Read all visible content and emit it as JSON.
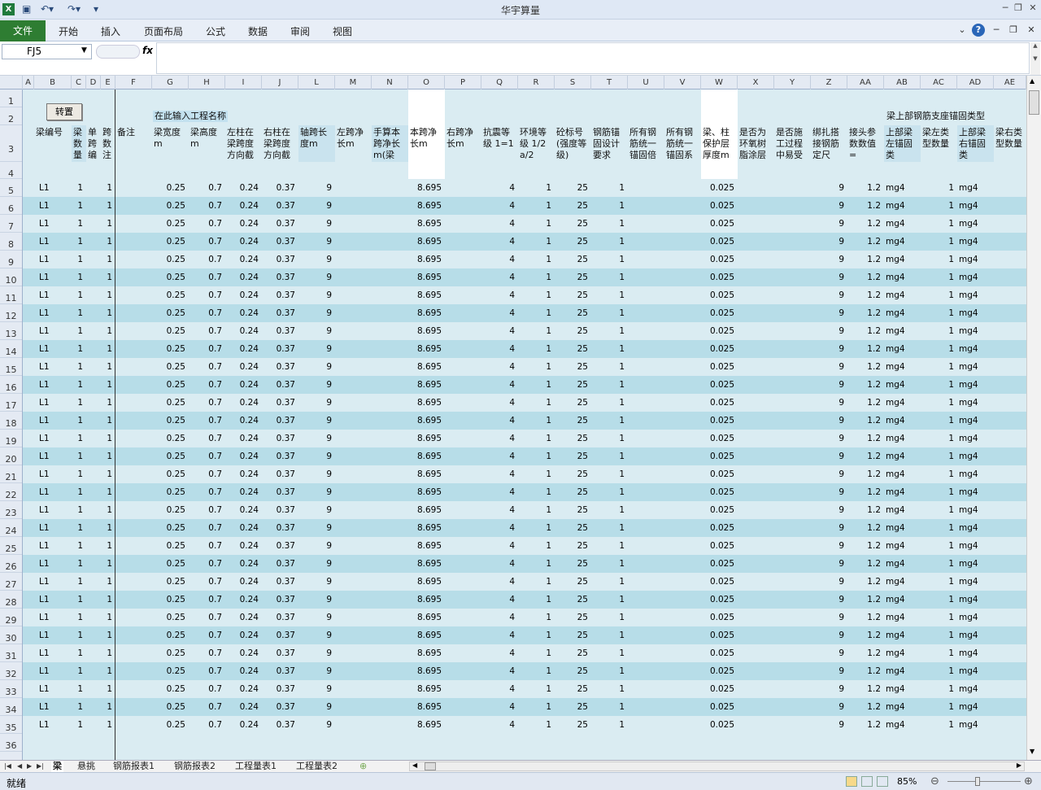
{
  "app": {
    "title": "华宇算量",
    "icon": "excel-icon"
  },
  "ribbon": {
    "file": "文件",
    "tabs": [
      "开始",
      "插入",
      "页面布局",
      "公式",
      "数据",
      "审阅",
      "视图"
    ]
  },
  "formula": {
    "namebox": "FJ5",
    "fx": "fx",
    "value": ""
  },
  "columns": [
    "A",
    "B",
    "C",
    "D",
    "E",
    "F",
    "G",
    "H",
    "I",
    "J",
    "L",
    "M",
    "N",
    "O",
    "P",
    "Q",
    "R",
    "S",
    "T",
    "U",
    "V",
    "W",
    "X",
    "Y",
    "Z",
    "AA",
    "AB",
    "AC",
    "AD",
    "AE"
  ],
  "rows": [
    "1",
    "2",
    "3",
    "4",
    "5",
    "6",
    "7",
    "8",
    "9",
    "10",
    "11",
    "12",
    "13",
    "14",
    "15",
    "16",
    "17",
    "18",
    "19",
    "20",
    "21",
    "22",
    "23",
    "24",
    "25",
    "26",
    "27",
    "28",
    "29",
    "30",
    "31",
    "32",
    "33",
    "34",
    "35",
    "36"
  ],
  "button": "转置",
  "project_label": "在此输入工程名称",
  "group_header": "梁上部钢筋支座锚固类型",
  "headers": {
    "B": "梁编号",
    "C": "梁数量",
    "D": "单跨编",
    "E": "跨数注",
    "F": "备注",
    "G": "梁宽度m",
    "H": "梁高度m",
    "I": "左柱在梁跨度方向截",
    "J": "右柱在梁跨度方向截",
    "L": "轴跨长度m",
    "M": "左跨净长m",
    "N": "手算本跨净长m(梁",
    "O": "本跨净长m",
    "P": "右跨净长m",
    "Q": "抗震等级 1=1",
    "R": "环境等级 1/2a/2",
    "S": "砼标号(强度等级)",
    "T": "钢筋锚固设计要求",
    "U": "所有钢筋统一锚固倍",
    "V": "所有钢筋统一锚固系",
    "W": "梁、柱保护层厚度m",
    "X": "是否为环氧树脂涂层",
    "Y": "是否施工过程中易受",
    "Z": "绑扎搭接钢筋定尺",
    "AA": "接头参数数值=",
    "AB": "上部梁左锚固类",
    "AC": "梁左类型数量",
    "AD": "上部梁右锚固类",
    "AE": "梁右类型数量"
  },
  "row_values": {
    "B": "L1",
    "C": "1",
    "E": "1",
    "G": "0.25",
    "H": "0.7",
    "I": "0.24",
    "J": "0.37",
    "L": "9",
    "O": "8.695",
    "Q": "4",
    "R": "1",
    "S": "25",
    "T": "1",
    "W": "0.025",
    "Z": "9",
    "AA": "1.2",
    "AB": "mg4",
    "AC": "1",
    "AD": "mg4"
  },
  "sheets": [
    "梁",
    "悬挑",
    "钢筋报表1",
    "钢筋报表2",
    "工程量表1",
    "工程量表2"
  ],
  "status": {
    "ready": "就绪",
    "zoom": "85%"
  }
}
